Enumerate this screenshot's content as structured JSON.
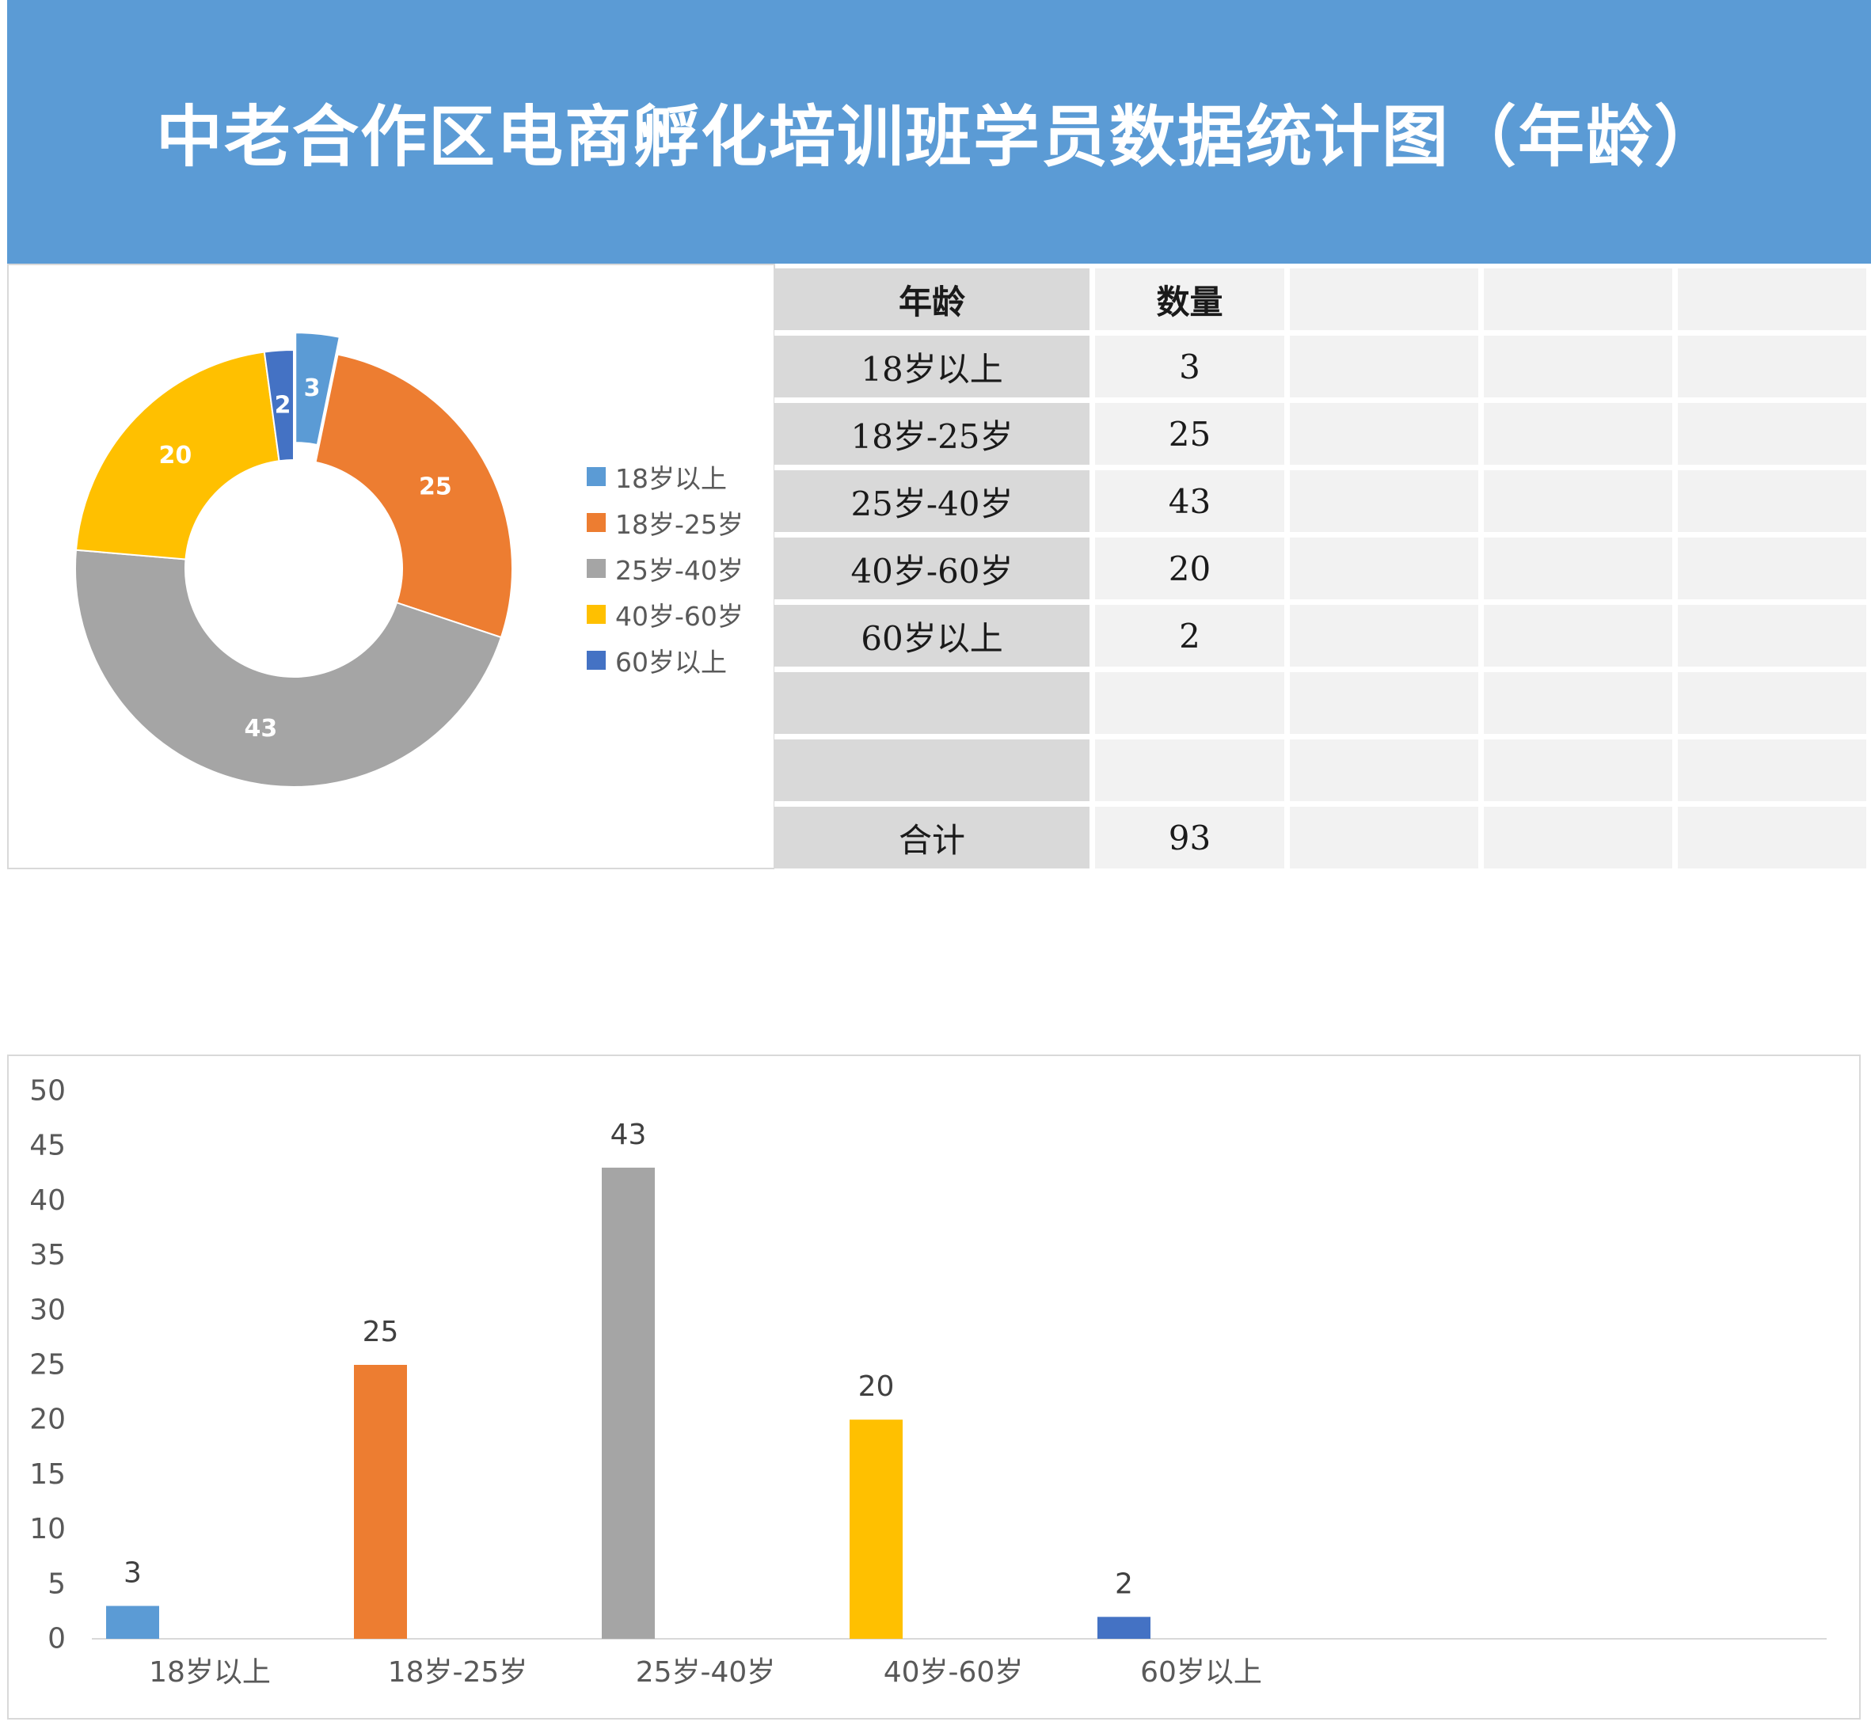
{
  "title": "中老合作区电商孵化培训班学员数据统计图（年龄）",
  "colors": {
    "header_bg": "#5b9bd5",
    "series": [
      "#5b9bd5",
      "#ed7d31",
      "#a5a5a5",
      "#ffc000",
      "#4472c4"
    ]
  },
  "table": {
    "headers": [
      "年龄",
      "数量",
      "",
      "",
      ""
    ],
    "rows": [
      [
        "18岁以上",
        "3"
      ],
      [
        "18岁-25岁",
        "25"
      ],
      [
        "25岁-40岁",
        "43"
      ],
      [
        "40岁-60岁",
        "20"
      ],
      [
        "60岁以上",
        "2"
      ],
      [
        "",
        ""
      ],
      [
        "",
        ""
      ]
    ],
    "total_label": "合计",
    "total_value": "93"
  },
  "chart_data": [
    {
      "type": "pie",
      "variant": "doughnut",
      "categories": [
        "18岁以上",
        "18岁-25岁",
        "25岁-40岁",
        "40岁-60岁",
        "60岁以上"
      ],
      "values": [
        3,
        25,
        43,
        20,
        2
      ],
      "exploded": [
        0
      ],
      "data_labels": true,
      "legend_position": "right"
    },
    {
      "type": "bar",
      "categories": [
        "18岁以上",
        "18岁-25岁",
        "25岁-40岁",
        "40岁-60岁",
        "60岁以上"
      ],
      "values": [
        3,
        25,
        43,
        20,
        2
      ],
      "ylim": [
        0,
        50
      ],
      "yticks": [
        0,
        5,
        10,
        15,
        20,
        25,
        30,
        35,
        40,
        45,
        50
      ],
      "data_labels": true,
      "grid": false
    }
  ]
}
